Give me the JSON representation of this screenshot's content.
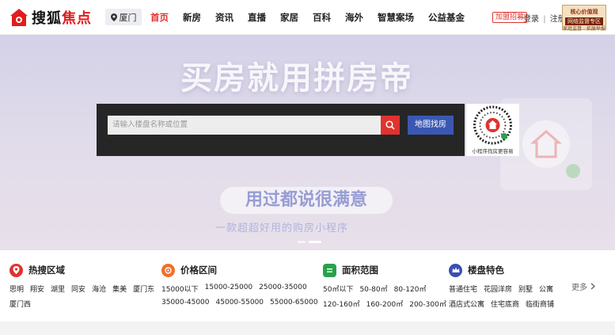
{
  "brand": {
    "part1": "搜狐",
    "part2": "焦点"
  },
  "city": {
    "label": "厦门",
    "icon": "location-pin-icon"
  },
  "nav": [
    {
      "label": "首页",
      "active": true
    },
    {
      "label": "新房"
    },
    {
      "label": "资讯"
    },
    {
      "label": "直播"
    },
    {
      "label": "家居"
    },
    {
      "label": "百科"
    },
    {
      "label": "海外"
    },
    {
      "label": "智慧案场"
    },
    {
      "label": "公益基金"
    }
  ],
  "header": {
    "join": "加盟招募",
    "login": "登录",
    "sep": "|",
    "register": "注册"
  },
  "ad": {
    "line1": "核心价值观",
    "line2": "网络监督专区",
    "line3": "家庭监督 · 拓展举报"
  },
  "hero": {
    "title": "买房就用拼房帝",
    "sub": "用过都说很满意",
    "sub2": "一款超超好用的购房小程序"
  },
  "search": {
    "placeholder": "请输入楼盘名称或位置",
    "map_button": "地图找房"
  },
  "qr": {
    "caption": "小程序找房更容易"
  },
  "filters": [
    {
      "title": "热搜区域",
      "icon": "location-pin-icon",
      "color": "#e0332f",
      "rows": [
        [
          "思明",
          "翔安",
          "湖里",
          "同安",
          "海沧",
          "集美",
          "厦门东"
        ],
        [
          "厦门西"
        ]
      ]
    },
    {
      "title": "价格区间",
      "icon": "price-tag-icon",
      "color": "#f0702a",
      "rows": [
        [
          "15000以下",
          "15000-25000",
          "25000-35000"
        ],
        [
          "35000-45000",
          "45000-55000",
          "55000-65000"
        ]
      ]
    },
    {
      "title": "面积范围",
      "icon": "area-icon",
      "color": "#2aa14a",
      "rows": [
        [
          "50㎡以下",
          "50-80㎡",
          "80-120㎡"
        ],
        [
          "120-160㎡",
          "160-200㎡",
          "200-300㎡"
        ]
      ]
    },
    {
      "title": "楼盘特色",
      "icon": "crown-icon",
      "color": "#3a4fb0",
      "rows": [
        [
          "普通住宅",
          "花园洋房",
          "别墅",
          "公寓"
        ],
        [
          "酒店式公寓",
          "住宅底商",
          "临街商铺"
        ]
      ]
    }
  ],
  "more": "更多"
}
